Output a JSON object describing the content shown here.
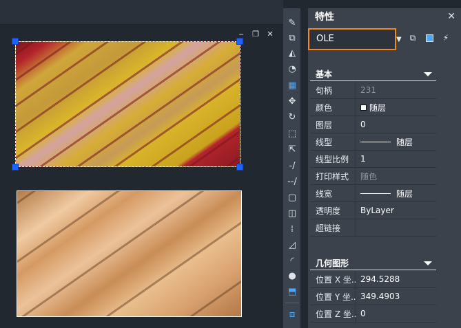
{
  "panel": {
    "title": "特性",
    "close_label": "✕"
  },
  "selector": {
    "value": "OLE",
    "caret": "▼"
  },
  "quick_buttons": [
    {
      "name": "toggle-pickadd-icon",
      "glyph": "⧉"
    },
    {
      "name": "select-objects-icon",
      "glyph": "⬚"
    },
    {
      "name": "quick-select-icon",
      "glyph": "⚡"
    }
  ],
  "sections": {
    "basic": {
      "title": "基本",
      "rows": [
        {
          "label": "句柄",
          "value": "231",
          "dim": true
        },
        {
          "label": "颜色",
          "value": "随层",
          "swatch": true
        },
        {
          "label": "图层",
          "value": "0"
        },
        {
          "label": "线型",
          "value": "随层",
          "line": true
        },
        {
          "label": "线型比例",
          "value": "1"
        },
        {
          "label": "打印样式",
          "value": "随色",
          "dim": true
        },
        {
          "label": "线宽",
          "value": "随层",
          "line": true
        },
        {
          "label": "透明度",
          "value": "ByLayer"
        },
        {
          "label": "超链接",
          "value": ""
        }
      ]
    },
    "geometry": {
      "title": "几何图形",
      "rows": [
        {
          "label": "位置 X 坐...",
          "value": "294.5288"
        },
        {
          "label": "位置 Y 坐...",
          "value": "349.4903"
        },
        {
          "label": "位置 Z 坐...",
          "value": "0"
        }
      ]
    }
  },
  "window_controls": {
    "minimize": "‒",
    "restore": "❐",
    "close": "✕"
  },
  "tools": [
    "eraser-icon",
    "copy-icon",
    "mirror-icon",
    "offset-icon",
    "array-icon",
    "move-icon",
    "rotate-icon",
    "scale-icon",
    "stretch-icon",
    "trim-icon",
    "extend-icon",
    "break-at-point-icon",
    "break-icon",
    "join-icon",
    "chamfer-icon",
    "fillet-icon",
    "blend-icon",
    "explode-icon",
    "draworder-icon"
  ]
}
